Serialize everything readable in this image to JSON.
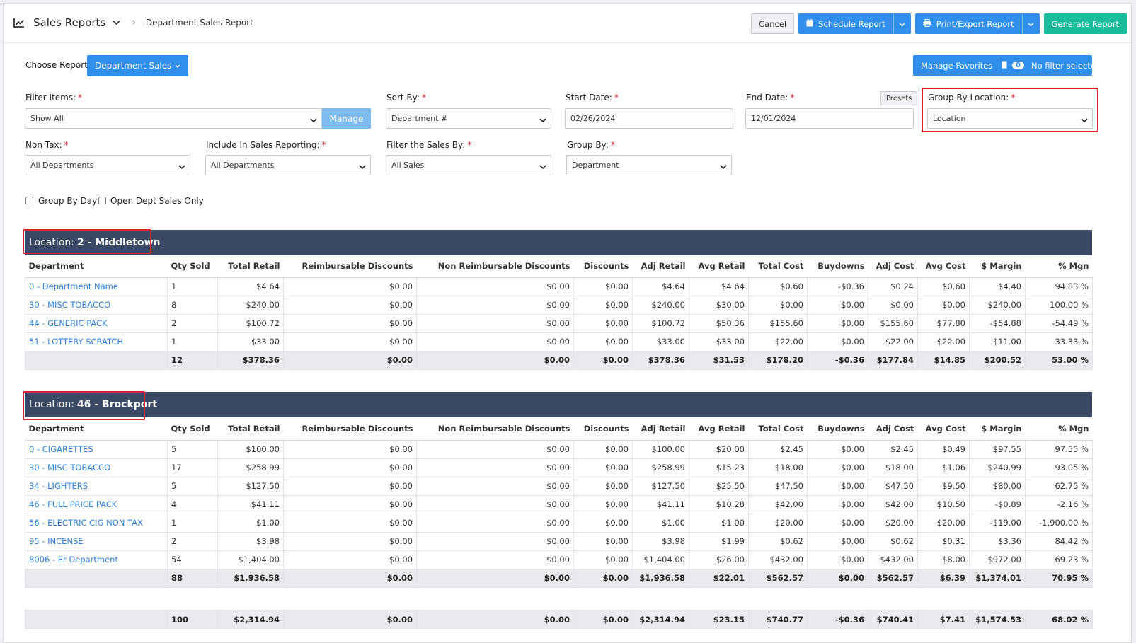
{
  "header": {
    "app_title": "Sales Reports",
    "breadcrumb": "Department Sales Report",
    "cancel_label": "Cancel",
    "schedule_label": "Schedule Report",
    "print_label": "Print/Export Report",
    "generate_label": "Generate Report"
  },
  "controls": {
    "choose_report_label": "Choose Report",
    "report_value": "Department Sales",
    "manage_favorites_label": "Manage Favorites",
    "filter_count": "0",
    "no_filter_label": "No filter selected",
    "presets_label": "Presets",
    "manage_label": "Manage",
    "group_by_day_label": "Group By Day",
    "open_dept_label": "Open Dept Sales Only"
  },
  "filters": {
    "filter_items": {
      "label": "Filter Items:",
      "value": "Show All"
    },
    "sort_by": {
      "label": "Sort By:",
      "value": "Department #"
    },
    "start_date": {
      "label": "Start Date:",
      "value": "02/26/2024"
    },
    "end_date": {
      "label": "End Date:",
      "value": "12/01/2024"
    },
    "group_by_location": {
      "label": "Group By Location:",
      "value": "Location"
    },
    "non_tax": {
      "label": "Non Tax:",
      "value": "All Departments"
    },
    "include_sales": {
      "label": "Include In Sales Reporting:",
      "value": "All Departments"
    },
    "filter_sales_by": {
      "label": "Filter the Sales By:",
      "value": "All Sales"
    },
    "group_by": {
      "label": "Group By:",
      "value": "Department"
    }
  },
  "columns": [
    "Department",
    "Qty Sold",
    "Total Retail",
    "Reimbursable Discounts",
    "Non Reimbursable Discounts",
    "Discounts",
    "Adj Retail",
    "Avg Retail",
    "Total Cost",
    "Buydowns",
    "Adj Cost",
    "Avg Cost",
    "$ Margin",
    "% Mgn"
  ],
  "locations": [
    {
      "prefix": "Location:",
      "name": "2 - Middletown",
      "rows": [
        [
          "0 - Department Name",
          "1",
          "$4.64",
          "$0.00",
          "$0.00",
          "$0.00",
          "$4.64",
          "$4.64",
          "$0.60",
          "-$0.36",
          "$0.24",
          "$0.60",
          "$4.40",
          "94.83 %"
        ],
        [
          "30 - MISC TOBACCO",
          "8",
          "$240.00",
          "$0.00",
          "$0.00",
          "$0.00",
          "$240.00",
          "$30.00",
          "$0.00",
          "$0.00",
          "$0.00",
          "$0.00",
          "$240.00",
          "100.00 %"
        ],
        [
          "44 - GENERIC PACK",
          "2",
          "$100.72",
          "$0.00",
          "$0.00",
          "$0.00",
          "$100.72",
          "$50.36",
          "$155.60",
          "$0.00",
          "$155.60",
          "$77.80",
          "-$54.88",
          "-54.49 %"
        ],
        [
          "51 - LOTTERY SCRATCH",
          "1",
          "$33.00",
          "$0.00",
          "$0.00",
          "$0.00",
          "$33.00",
          "$33.00",
          "$22.00",
          "$0.00",
          "$22.00",
          "$22.00",
          "$11.00",
          "33.33 %"
        ]
      ],
      "total": [
        "",
        "12",
        "$378.36",
        "$0.00",
        "$0.00",
        "$0.00",
        "$378.36",
        "$31.53",
        "$178.20",
        "-$0.36",
        "$177.84",
        "$14.85",
        "$200.52",
        "53.00 %"
      ]
    },
    {
      "prefix": "Location:",
      "name": "46 - Brockport",
      "rows": [
        [
          "0 - CIGARETTES",
          "5",
          "$100.00",
          "$0.00",
          "$0.00",
          "$0.00",
          "$100.00",
          "$20.00",
          "$2.45",
          "$0.00",
          "$2.45",
          "$0.49",
          "$97.55",
          "97.55 %"
        ],
        [
          "30 - MISC TOBACCO",
          "17",
          "$258.99",
          "$0.00",
          "$0.00",
          "$0.00",
          "$258.99",
          "$15.23",
          "$18.00",
          "$0.00",
          "$18.00",
          "$1.06",
          "$240.99",
          "93.05 %"
        ],
        [
          "34 - LIGHTERS",
          "5",
          "$127.50",
          "$0.00",
          "$0.00",
          "$0.00",
          "$127.50",
          "$25.50",
          "$47.50",
          "$0.00",
          "$47.50",
          "$9.50",
          "$80.00",
          "62.75 %"
        ],
        [
          "46 - FULL PRICE PACK",
          "4",
          "$41.11",
          "$0.00",
          "$0.00",
          "$0.00",
          "$41.11",
          "$10.28",
          "$42.00",
          "$0.00",
          "$42.00",
          "$10.50",
          "-$0.89",
          "-2.16 %"
        ],
        [
          "56 - ELECTRIC CIG NON TAX",
          "1",
          "$1.00",
          "$0.00",
          "$0.00",
          "$0.00",
          "$1.00",
          "$1.00",
          "$20.00",
          "$0.00",
          "$20.00",
          "$20.00",
          "-$19.00",
          "-1,900.00 %"
        ],
        [
          "95 - INCENSE",
          "2",
          "$3.98",
          "$0.00",
          "$0.00",
          "$0.00",
          "$3.98",
          "$1.99",
          "$0.62",
          "$0.00",
          "$0.62",
          "$0.31",
          "$3.36",
          "84.42 %"
        ],
        [
          "8006 - Er Department",
          "54",
          "$1,404.00",
          "$0.00",
          "$0.00",
          "$0.00",
          "$1,404.00",
          "$26.00",
          "$432.00",
          "$0.00",
          "$432.00",
          "$8.00",
          "$972.00",
          "69.23 %"
        ]
      ],
      "total": [
        "",
        "88",
        "$1,936.58",
        "$0.00",
        "$0.00",
        "$0.00",
        "$1,936.58",
        "$22.01",
        "$562.57",
        "$0.00",
        "$562.57",
        "$6.39",
        "$1,374.01",
        "70.95 %"
      ]
    }
  ],
  "grand_total": [
    "",
    "100",
    "$2,314.94",
    "$0.00",
    "$0.00",
    "$0.00",
    "$2,314.94",
    "$23.15",
    "$740.77",
    "-$0.36",
    "$740.41",
    "$7.41",
    "$1,574.53",
    "68.02 %"
  ],
  "colors": {
    "accent": "#2f8fea",
    "generate": "#1abc9c",
    "location_bar": "#3a4a66",
    "highlight": "#d9232d",
    "link": "#2f7fd6"
  }
}
